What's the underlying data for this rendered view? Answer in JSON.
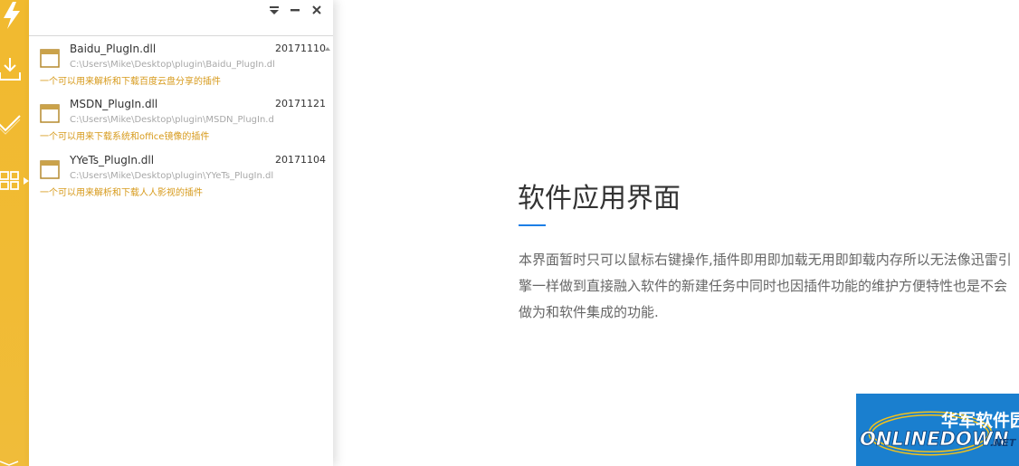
{
  "window": {
    "plugins": [
      {
        "name": "Baidu_PlugIn.dll",
        "date": "20171110",
        "path": "C:\\Users\\Mike\\Desktop\\plugin\\Baidu_PlugIn.dll",
        "description": "一个可以用来解析和下载百度云盘分享的插件"
      },
      {
        "name": "MSDN_PlugIn.dll",
        "date": "20171121",
        "path": "C:\\Users\\Mike\\Desktop\\plugin\\MSDN_PlugIn.dll",
        "description": "一个可以用来下载系统和office镜像的插件"
      },
      {
        "name": "YYeTs_PlugIn.dll",
        "date": "20171104",
        "path": "C:\\Users\\Mike\\Desktop\\plugin\\YYeTs_PlugIn.dll",
        "description": "一个可以用来解析和下载人人影视的插件"
      }
    ]
  },
  "feature": {
    "title": "软件应用界面",
    "body": "本界面暂时只可以鼠标右键操作,插件即用即加载无用即卸载内存所以无法像迅雷引擎一样做到直接融入软件的新建任务中同时也因插件功能的维护方便特性也是不会做为和软件集成的功能."
  },
  "watermark": {
    "cn": "华军软件园",
    "en": "ONLINEDOWN",
    "suffix": ".NET"
  },
  "icons": {
    "sidebar": [
      "lightning-icon",
      "download-icon",
      "check-icon",
      "grid-icon",
      "mail-icon"
    ],
    "titlebar": [
      "dropdown-menu-icon",
      "minimize-icon",
      "close-icon"
    ],
    "item": "window-app-icon"
  },
  "colors": {
    "sidebar": "#f1ba2f",
    "description_text": "#d79a1b",
    "accent_line": "#1c7ee6",
    "watermark_bg": "#1a7fcf"
  }
}
